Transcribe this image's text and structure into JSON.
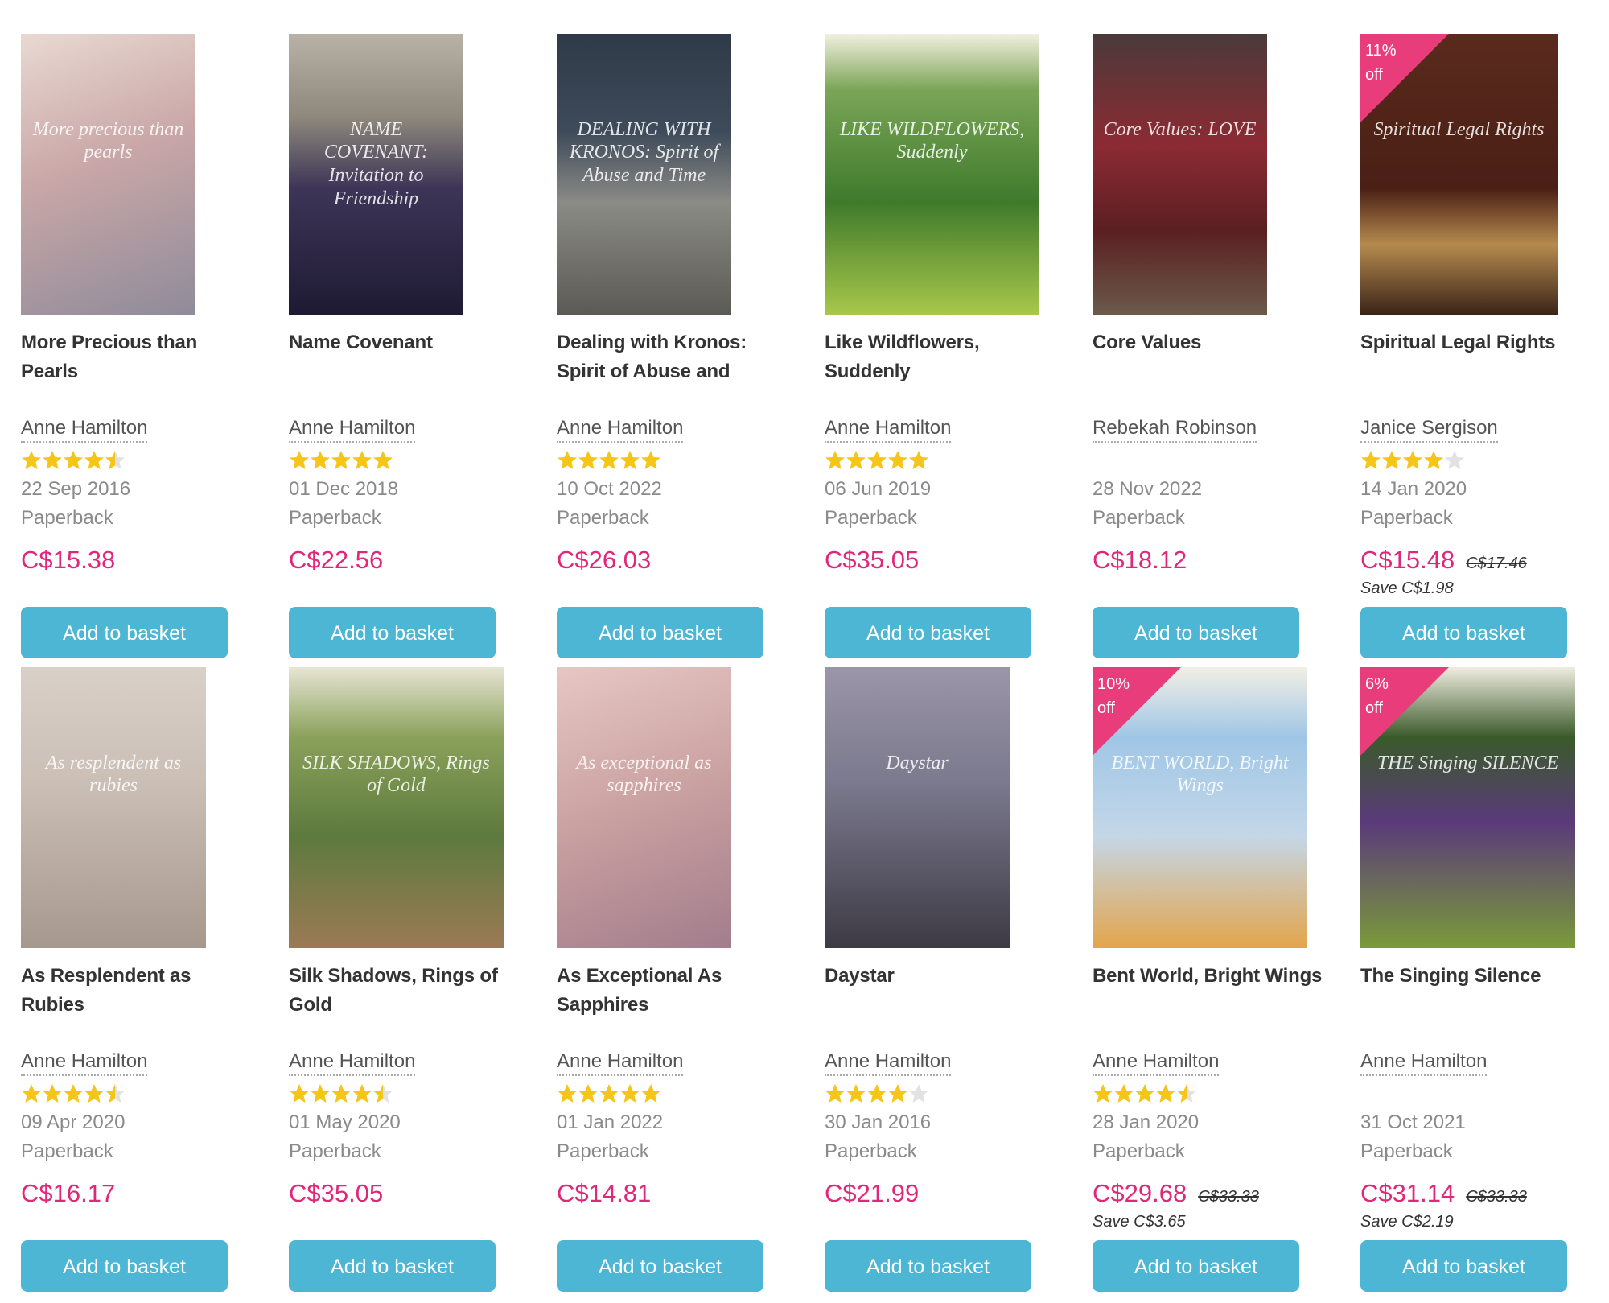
{
  "colors": {
    "price": "#e0287a",
    "button": "#4db6d4",
    "discount": "#e83d7a",
    "star": "#f5c518"
  },
  "books": [
    {
      "title": "More Precious than Pearls",
      "author": "Anne Hamilton",
      "rating": 4.5,
      "date": "22 Sep 2016",
      "format": "Paperback",
      "price": "C$15.38",
      "button": "Add to basket",
      "cover_text": "More precious than pearls"
    },
    {
      "title": "Name Covenant",
      "author": "Anne Hamilton",
      "rating": 5,
      "date": "01 Dec 2018",
      "format": "Paperback",
      "price": "C$22.56",
      "button": "Add to basket",
      "cover_text": "NAME COVENANT: Invitation to Friendship"
    },
    {
      "title": "Dealing with Kronos: Spirit of Abuse and",
      "author": "Anne Hamilton",
      "rating": 5,
      "date": "10 Oct 2022",
      "format": "Paperback",
      "price": "C$26.03",
      "button": "Add to basket",
      "cover_text": "DEALING WITH KRONOS: Spirit of Abuse and Time"
    },
    {
      "title": "Like Wildflowers, Suddenly",
      "author": "Anne Hamilton",
      "rating": 5,
      "date": "06 Jun 2019",
      "format": "Paperback",
      "price": "C$35.05",
      "button": "Add to basket",
      "cover_text": "LIKE WILDFLOWERS, Suddenly"
    },
    {
      "title": "Core Values",
      "author": "Rebekah Robinson",
      "rating": 0,
      "date": "28 Nov 2022",
      "format": "Paperback",
      "price": "C$18.12",
      "button": "Add to basket",
      "cover_text": "Core Values: LOVE"
    },
    {
      "title": "Spiritual Legal Rights",
      "author": "Janice Sergison",
      "rating": 4,
      "date": "14 Jan 2020",
      "format": "Paperback",
      "price": "C$15.48",
      "rrp": "C$17.46",
      "save": "Save C$1.98",
      "discount": "11% off",
      "button": "Add to basket",
      "cover_text": "Spiritual Legal Rights"
    },
    {
      "title": "As Resplendent as Rubies",
      "author": "Anne Hamilton",
      "rating": 4.5,
      "date": "09 Apr 2020",
      "format": "Paperback",
      "price": "C$16.17",
      "button": "Add to basket",
      "cover_text": "As resplendent as rubies"
    },
    {
      "title": "Silk Shadows, Rings of Gold",
      "author": "Anne Hamilton",
      "rating": 4.5,
      "date": "01 May 2020",
      "format": "Paperback",
      "price": "C$35.05",
      "button": "Add to basket",
      "cover_text": "SILK SHADOWS, Rings of Gold"
    },
    {
      "title": "As Exceptional As Sapphires",
      "author": "Anne Hamilton",
      "rating": 5,
      "date": "01 Jan 2022",
      "format": "Paperback",
      "price": "C$14.81",
      "button": "Add to basket",
      "cover_text": "As exceptional as sapphires"
    },
    {
      "title": "Daystar",
      "author": "Anne Hamilton",
      "rating": 4,
      "date": "30 Jan 2016",
      "format": "Paperback",
      "price": "C$21.99",
      "button": "Add to basket",
      "cover_text": "Daystar"
    },
    {
      "title": "Bent World, Bright Wings",
      "author": "Anne Hamilton",
      "rating": 4.5,
      "date": "28 Jan 2020",
      "format": "Paperback",
      "price": "C$29.68",
      "rrp": "C$33.33",
      "save": "Save C$3.65",
      "discount": "10% off",
      "button": "Add to basket",
      "cover_text": "BENT WORLD, Bright Wings"
    },
    {
      "title": "The Singing Silence",
      "author": "Anne Hamilton",
      "rating": 0,
      "date": "31 Oct 2021",
      "format": "Paperback",
      "price": "C$31.14",
      "rrp": "C$33.33",
      "save": "Save C$2.19",
      "discount": "6% off",
      "button": "Add to basket",
      "cover_text": "THE Singing SILENCE"
    }
  ]
}
